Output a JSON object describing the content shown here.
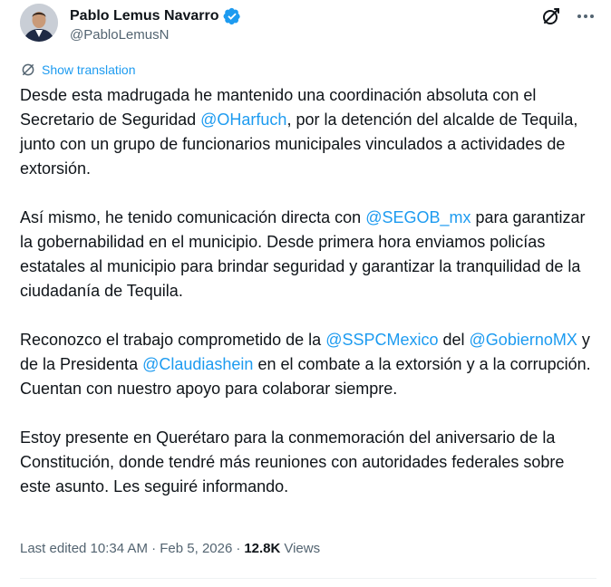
{
  "author": {
    "display_name": "Pablo Lemus Navarro",
    "handle": "@PabloLemusN"
  },
  "icons": {
    "verified": "verified-badge-icon",
    "grok": "grok-icon",
    "more": "more-options-icon",
    "translate": "translate-icon"
  },
  "colors": {
    "link": "#1d9bf0",
    "text": "#0f1419",
    "secondary": "#536471"
  },
  "translate_label": "Show translation",
  "paragraphs": [
    [
      {
        "text": "Desde esta madrugada he mantenido una coordinación absoluta con el Secretario de Seguridad "
      },
      {
        "text": "@OHarfuch",
        "mention": true
      },
      {
        "text": ", por la detención del alcalde de Tequila, junto con un grupo de funcionarios municipales vinculados a actividades de extorsión."
      }
    ],
    [
      {
        "text": "Así mismo, he tenido comunicación directa con "
      },
      {
        "text": "@SEGOB_mx",
        "mention": true
      },
      {
        "text": " para garantizar la gobernabilidad en el municipio. Desde primera hora enviamos policías estatales al municipio para brindar seguridad y garantizar la tranquilidad de la ciudadanía de Tequila."
      }
    ],
    [
      {
        "text": "Reconozco el trabajo comprometido de la "
      },
      {
        "text": "@SSPCMexico",
        "mention": true
      },
      {
        "text": " del "
      },
      {
        "text": "@GobiernoMX",
        "mention": true
      },
      {
        "text": " y de la Presidenta "
      },
      {
        "text": "@Claudiashein",
        "mention": true
      },
      {
        "text": " en el combate a la extorsión y a la corrupción. Cuentan con nuestro apoyo para colaborar siempre."
      }
    ],
    [
      {
        "text": "Estoy presente en Querétaro para la conmemoración del aniversario de la Constitución, donde tendré más reuniones con autoridades federales sobre este asunto. Les seguiré informando."
      }
    ]
  ],
  "meta": {
    "edited_label": "Last edited 10:34 AM · Feb 5, 2026",
    "separator": "·",
    "views_count": "12.8K",
    "views_label": "Views"
  }
}
